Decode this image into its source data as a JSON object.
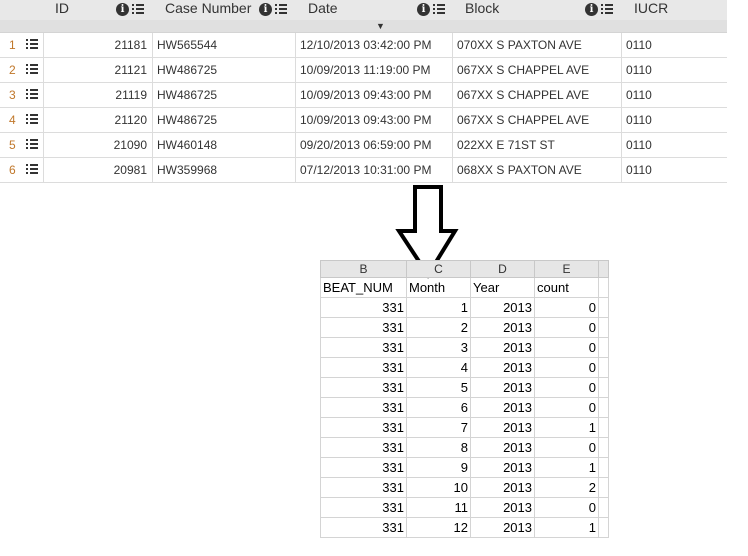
{
  "grid": {
    "headers": [
      {
        "label": "ID"
      },
      {
        "label": "Case Number"
      },
      {
        "label": "Date"
      },
      {
        "label": "Block"
      },
      {
        "label": "IUCR"
      }
    ],
    "rows": [
      {
        "num": "1",
        "id": "21181",
        "case": "HW565544",
        "date": "12/10/2013 03:42:00 PM",
        "block": "070XX S PAXTON AVE",
        "iucr": "0110"
      },
      {
        "num": "2",
        "id": "21121",
        "case": "HW486725",
        "date": "10/09/2013 11:19:00 PM",
        "block": "067XX S CHAPPEL AVE",
        "iucr": "0110"
      },
      {
        "num": "3",
        "id": "21119",
        "case": "HW486725",
        "date": "10/09/2013 09:43:00 PM",
        "block": "067XX S CHAPPEL AVE",
        "iucr": "0110"
      },
      {
        "num": "4",
        "id": "21120",
        "case": "HW486725",
        "date": "10/09/2013 09:43:00 PM",
        "block": "067XX S CHAPPEL AVE",
        "iucr": "0110"
      },
      {
        "num": "5",
        "id": "21090",
        "case": "HW460148",
        "date": "09/20/2013 06:59:00 PM",
        "block": "022XX E 71ST ST",
        "iucr": "0110"
      },
      {
        "num": "6",
        "id": "20981",
        "case": "HW359968",
        "date": "07/12/2013 10:31:00 PM",
        "block": "068XX S PAXTON AVE",
        "iucr": "0110"
      }
    ]
  },
  "sheet": {
    "col_letters": [
      "B",
      "C",
      "D",
      "E",
      ""
    ],
    "headers": [
      "BEAT_NUM",
      "Month",
      "Year",
      "count"
    ],
    "rows": [
      [
        "331",
        "1",
        "2013",
        "0"
      ],
      [
        "331",
        "2",
        "2013",
        "0"
      ],
      [
        "331",
        "3",
        "2013",
        "0"
      ],
      [
        "331",
        "4",
        "2013",
        "0"
      ],
      [
        "331",
        "5",
        "2013",
        "0"
      ],
      [
        "331",
        "6",
        "2013",
        "0"
      ],
      [
        "331",
        "7",
        "2013",
        "1"
      ],
      [
        "331",
        "8",
        "2013",
        "0"
      ],
      [
        "331",
        "9",
        "2013",
        "1"
      ],
      [
        "331",
        "10",
        "2013",
        "2"
      ],
      [
        "331",
        "11",
        "2013",
        "0"
      ],
      [
        "331",
        "12",
        "2013",
        "1"
      ]
    ]
  },
  "icons": {
    "info": "info-icon",
    "menu": "list-menu-icon",
    "caret": "caret-down-icon",
    "arrow": "down-arrow-icon"
  }
}
